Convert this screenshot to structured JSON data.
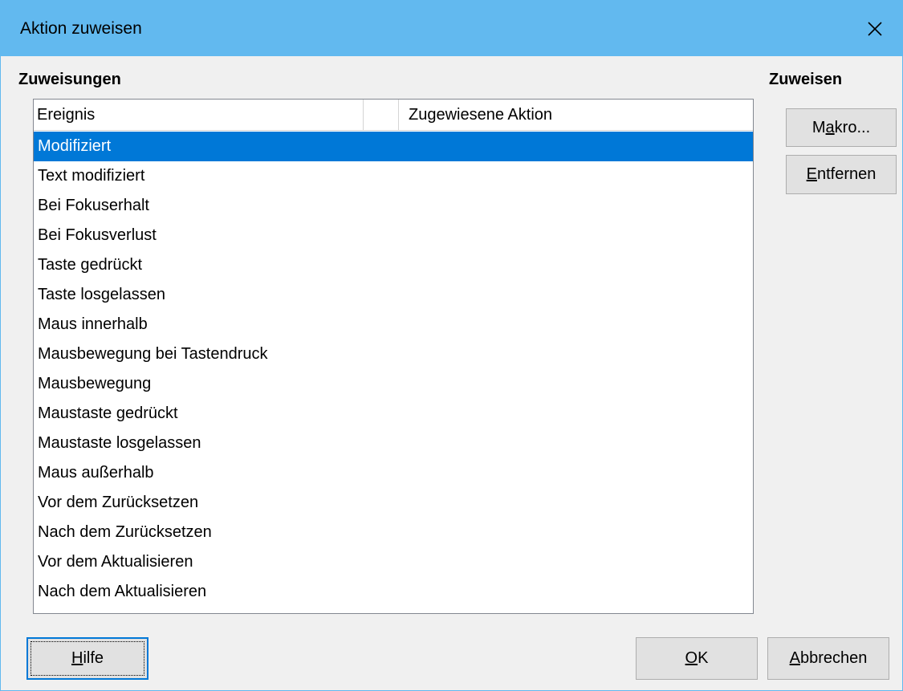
{
  "window": {
    "title": "Aktion zuweisen"
  },
  "assignments": {
    "heading": "Zuweisungen",
    "columns": [
      "Ereignis",
      "",
      "Zugewiesene Aktion"
    ],
    "selected_index": 0,
    "events": [
      "Modifiziert",
      "Text modifiziert",
      "Bei Fokuserhalt",
      "Bei Fokusverlust",
      "Taste gedrückt",
      "Taste losgelassen",
      "Maus innerhalb",
      "Mausbewegung bei Tastendruck",
      "Mausbewegung",
      "Maustaste gedrückt",
      "Maustaste losgelassen",
      "Maus außerhalb",
      "Vor dem Zurücksetzen",
      "Nach dem Zurücksetzen",
      "Vor dem Aktualisieren",
      "Nach dem Aktualisieren"
    ]
  },
  "assign_panel": {
    "heading": "Zuweisen",
    "macro_label": "Makro...",
    "remove_label": "Entfernen"
  },
  "footer": {
    "help_label": "Hilfe",
    "ok_label": "OK",
    "cancel_label": "Abbrechen"
  },
  "colors": {
    "titlebar": "#62b9ef",
    "selection": "#0078d7"
  }
}
